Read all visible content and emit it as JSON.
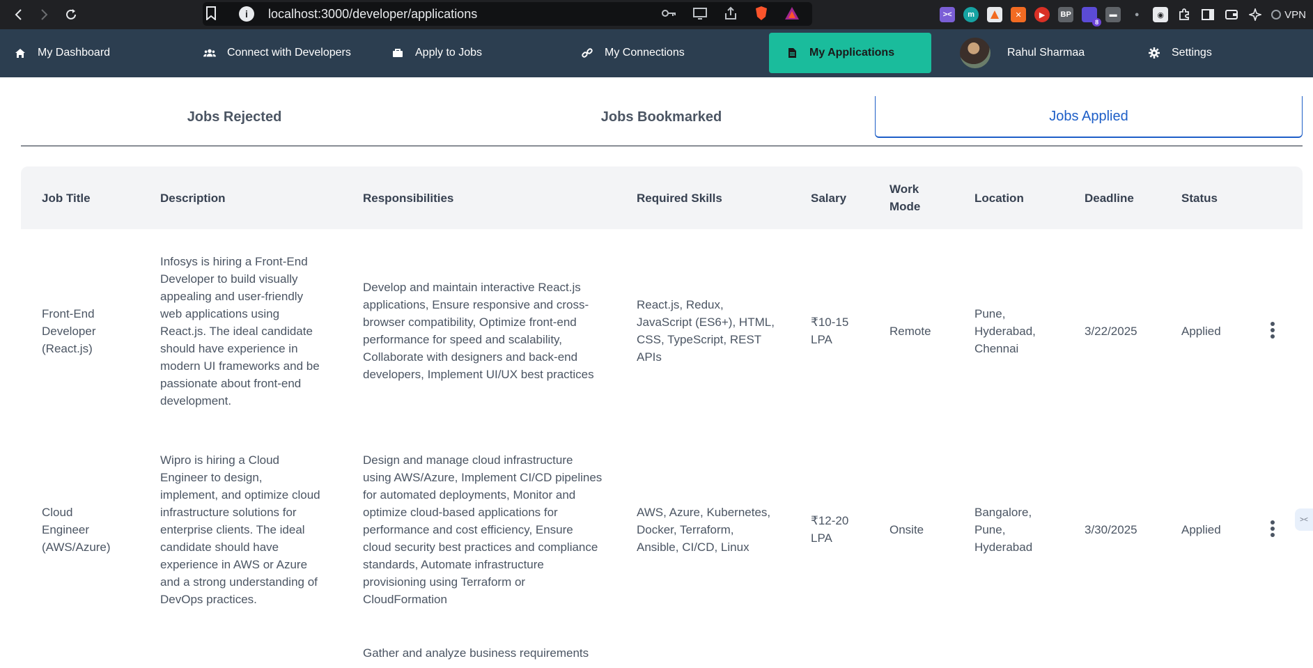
{
  "browser": {
    "url": "localhost:3000/developer/applications",
    "vpn_label": "VPN",
    "extension_badge": "8",
    "ext_bp": "BP",
    "ext_m": "m"
  },
  "nav": {
    "items": [
      {
        "label": "My Dashboard",
        "icon": "home-icon"
      },
      {
        "label": "Connect with Developers",
        "icon": "users-icon"
      },
      {
        "label": "Apply to Jobs",
        "icon": "briefcase-icon"
      },
      {
        "label": "My Connections",
        "icon": "link-icon"
      },
      {
        "label": "My Applications",
        "icon": "document-icon"
      },
      {
        "label": "Rahul Sharmaa",
        "icon": "avatar"
      },
      {
        "label": "Settings",
        "icon": "gear-icon"
      }
    ],
    "active_color": "#1abc9c",
    "bg_color": "#2c3e50"
  },
  "tabs": [
    {
      "label": "Jobs Rejected"
    },
    {
      "label": "Jobs Bookmarked"
    },
    {
      "label": "Jobs Applied",
      "active": true
    }
  ],
  "table": {
    "headers": [
      "Job Title",
      "Description",
      "Responsibilities",
      "Required Skills",
      "Salary",
      "Work Mode",
      "Location",
      "Deadline",
      "Status"
    ],
    "rows": [
      {
        "title": "Front-End Developer (React.js)",
        "description": "Infosys is hiring a Front-End Developer to build visually appealing and user-friendly web applications using React.js. The ideal candidate should have experience in modern UI frameworks and be passionate about front-end development.",
        "responsibilities": "Develop and maintain interactive React.js applications, Ensure responsive and cross-browser compatibility, Optimize front-end performance for speed and scalability, Collaborate with designers and back-end developers, Implement UI/UX best practices",
        "skills": "React.js, Redux, JavaScript (ES6+), HTML, CSS, TypeScript, REST APIs",
        "salary": "₹10-15 LPA",
        "work_mode": "Remote",
        "location": "Pune, Hyderabad, Chennai",
        "deadline": "3/22/2025",
        "status": "Applied"
      },
      {
        "title": "Cloud Engineer (AWS/Azure)",
        "description": "Wipro is hiring a Cloud Engineer to design, implement, and optimize cloud infrastructure solutions for enterprise clients. The ideal candidate should have experience in AWS or Azure and a strong understanding of DevOps practices.",
        "responsibilities": "Design and manage cloud infrastructure using AWS/Azure, Implement CI/CD pipelines for automated deployments, Monitor and optimize cloud-based applications for performance and cost efficiency, Ensure cloud security best practices and compliance standards, Automate infrastructure provisioning using Terraform or CloudFormation",
        "skills": "AWS, Azure, Kubernetes, Docker, Terraform, Ansible, CI/CD, Linux",
        "salary": "₹12-20 LPA",
        "work_mode": "Onsite",
        "location": "Bangalore, Pune, Hyderabad",
        "deadline": "3/30/2025",
        "status": "Applied"
      },
      {
        "responsibilities": "Gather and analyze business requirements"
      }
    ]
  }
}
